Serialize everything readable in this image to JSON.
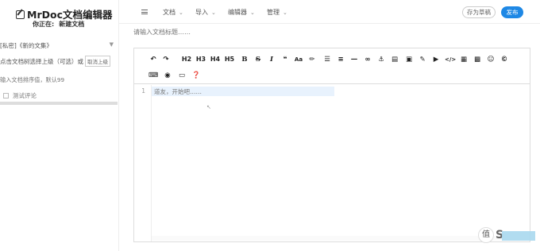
{
  "sidebar": {
    "brand": "MrDoc文档编辑器",
    "location_label": "你正在:",
    "location_doc": "新建文档",
    "project": "[私密]《新的文集》",
    "parent_label": "点击文档树选择上级（可选）或",
    "parent_cancel": "取消上级",
    "sort_placeholder": "输入文档排序值，默认99",
    "comment_label": "测试评论"
  },
  "topbar": {
    "nav": [
      "文档",
      "导入",
      "编辑器",
      "管理"
    ],
    "draft_label": "存为草稿",
    "publish_label": "发布"
  },
  "editor": {
    "title_placeholder": "请输入文档标题……",
    "content_placeholder": "道友，开始吧……",
    "line_number": "1",
    "toolbar_row1": [
      "undo",
      "redo",
      "H2",
      "H3",
      "H4",
      "H5",
      "B",
      "S",
      "I",
      "quote",
      "case",
      "paint",
      "ul",
      "ol",
      "hr",
      "link",
      "anchor",
      "chart",
      "image",
      "table-edit",
      "video",
      "code",
      "code-block",
      "table",
      "emoji",
      "copyright"
    ],
    "toolbar_row2": [
      "keyboard",
      "preview",
      "fullscreen",
      "help"
    ],
    "heading_labels": [
      "H2",
      "H3",
      "H4",
      "H5"
    ]
  },
  "watermark": {
    "text": "S",
    "circle": "值"
  },
  "colors": {
    "accent": "#1e88e5",
    "active_line": "#e8f2fd"
  }
}
